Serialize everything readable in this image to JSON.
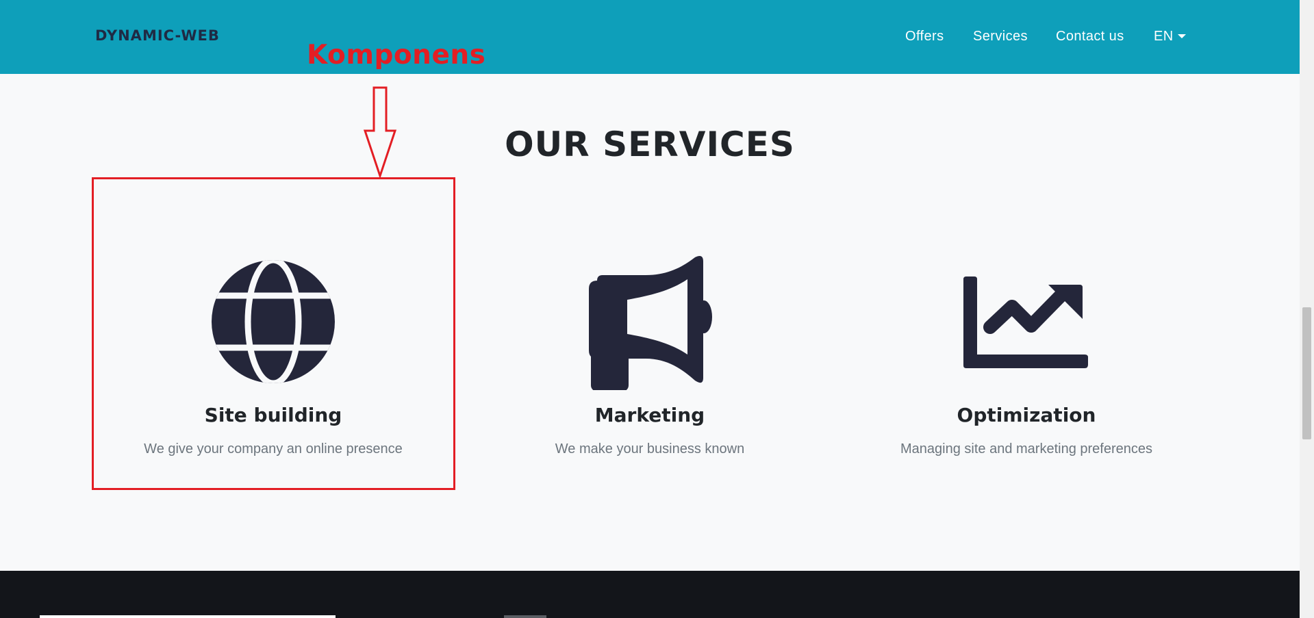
{
  "navbar": {
    "brand": "DYNAMIC-WEB",
    "links": [
      "Offers",
      "Services",
      "Contact us"
    ],
    "language": "EN"
  },
  "section": {
    "title": "OUR SERVICES"
  },
  "services": [
    {
      "icon": "globe-icon",
      "title": "Site building",
      "description": "We give your company an online presence"
    },
    {
      "icon": "megaphone-icon",
      "title": "Marketing",
      "description": "We make your business known"
    },
    {
      "icon": "chart-line-icon",
      "title": "Optimization",
      "description": "Managing site and marketing preferences"
    }
  ],
  "annotation": {
    "label": "Komponens",
    "color": "#e31e24"
  },
  "colors": {
    "navbar_bg": "#0e9fba",
    "brand_text": "#1f2a44",
    "icon_fill": "#24263a",
    "page_bg": "#f8f9fa",
    "footer_bg": "#13151a"
  }
}
